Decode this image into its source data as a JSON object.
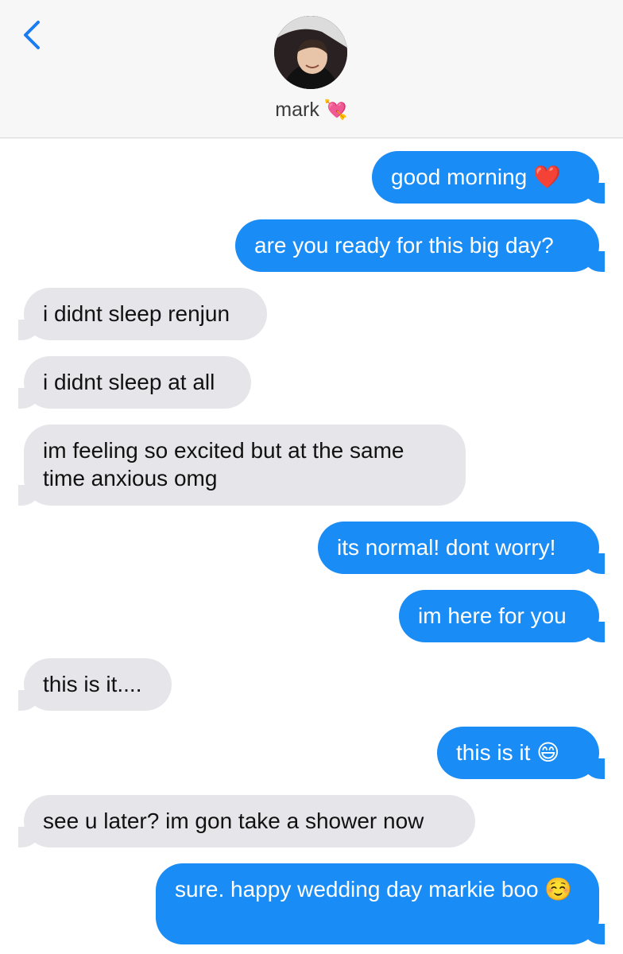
{
  "header": {
    "contact_name": "mark",
    "contact_emoji": "💘"
  },
  "icons": {
    "back": "chevron-left-icon"
  },
  "colors": {
    "sent_bubble": "#1a8cf5",
    "received_bubble": "#e6e5ea",
    "accent": "#1a7cf2"
  },
  "messages": [
    {
      "direction": "sent",
      "text": "good morning",
      "emoji": "❤️"
    },
    {
      "direction": "sent",
      "text": "are you ready for this big day?"
    },
    {
      "direction": "received",
      "text": "i didnt sleep renjun"
    },
    {
      "direction": "received",
      "text": "i didnt sleep at all"
    },
    {
      "direction": "received",
      "text": "im feeling so excited but at the same time anxious omg"
    },
    {
      "direction": "sent",
      "text": "its normal! dont worry!"
    },
    {
      "direction": "sent",
      "text": "im here for you"
    },
    {
      "direction": "received",
      "text": "this is it...."
    },
    {
      "direction": "sent",
      "text": "this is it",
      "emoji": "😄"
    },
    {
      "direction": "received",
      "text": "see u later? im gon take a shower now"
    },
    {
      "direction": "sent",
      "text": "sure. happy wedding day markie boo",
      "emoji": "☺️"
    }
  ]
}
